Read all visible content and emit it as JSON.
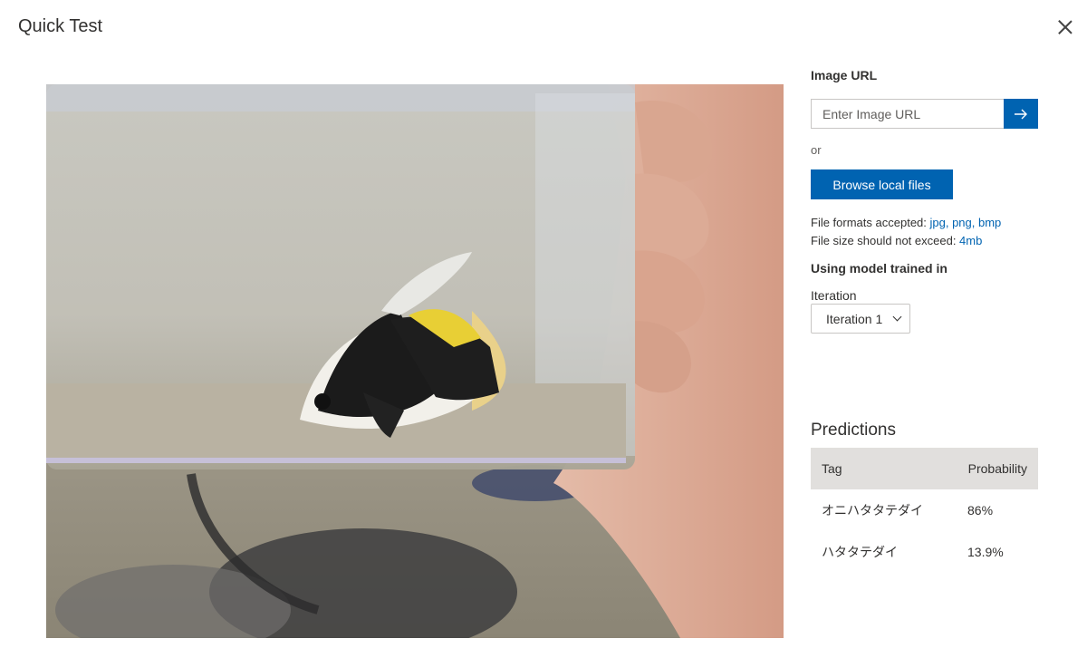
{
  "dialog": {
    "title": "Quick Test"
  },
  "image_url": {
    "label": "Image URL",
    "placeholder": "Enter Image URL"
  },
  "or_text": "or",
  "browse_button": "Browse local files",
  "file_info": {
    "formats_prefix": "File formats accepted: ",
    "formats": "jpg, png, bmp",
    "size_prefix": "File size should not exceed: ",
    "size": "4mb"
  },
  "model": {
    "label": "Using model trained in",
    "iteration_label": "Iteration",
    "iteration_value": "Iteration 1"
  },
  "predictions": {
    "title": "Predictions",
    "columns": [
      "Tag",
      "Probability"
    ],
    "rows": [
      {
        "tag": "オニハタタテダイ",
        "probability": "86%"
      },
      {
        "tag": "ハタタテダイ",
        "probability": "13.9%"
      }
    ]
  },
  "colors": {
    "accent": "#0063b1",
    "header_bg": "#e1dfdd"
  },
  "icons": {
    "submit": "arrow-right-icon",
    "close": "close-icon",
    "dropdown": "chevron-down-icon"
  }
}
